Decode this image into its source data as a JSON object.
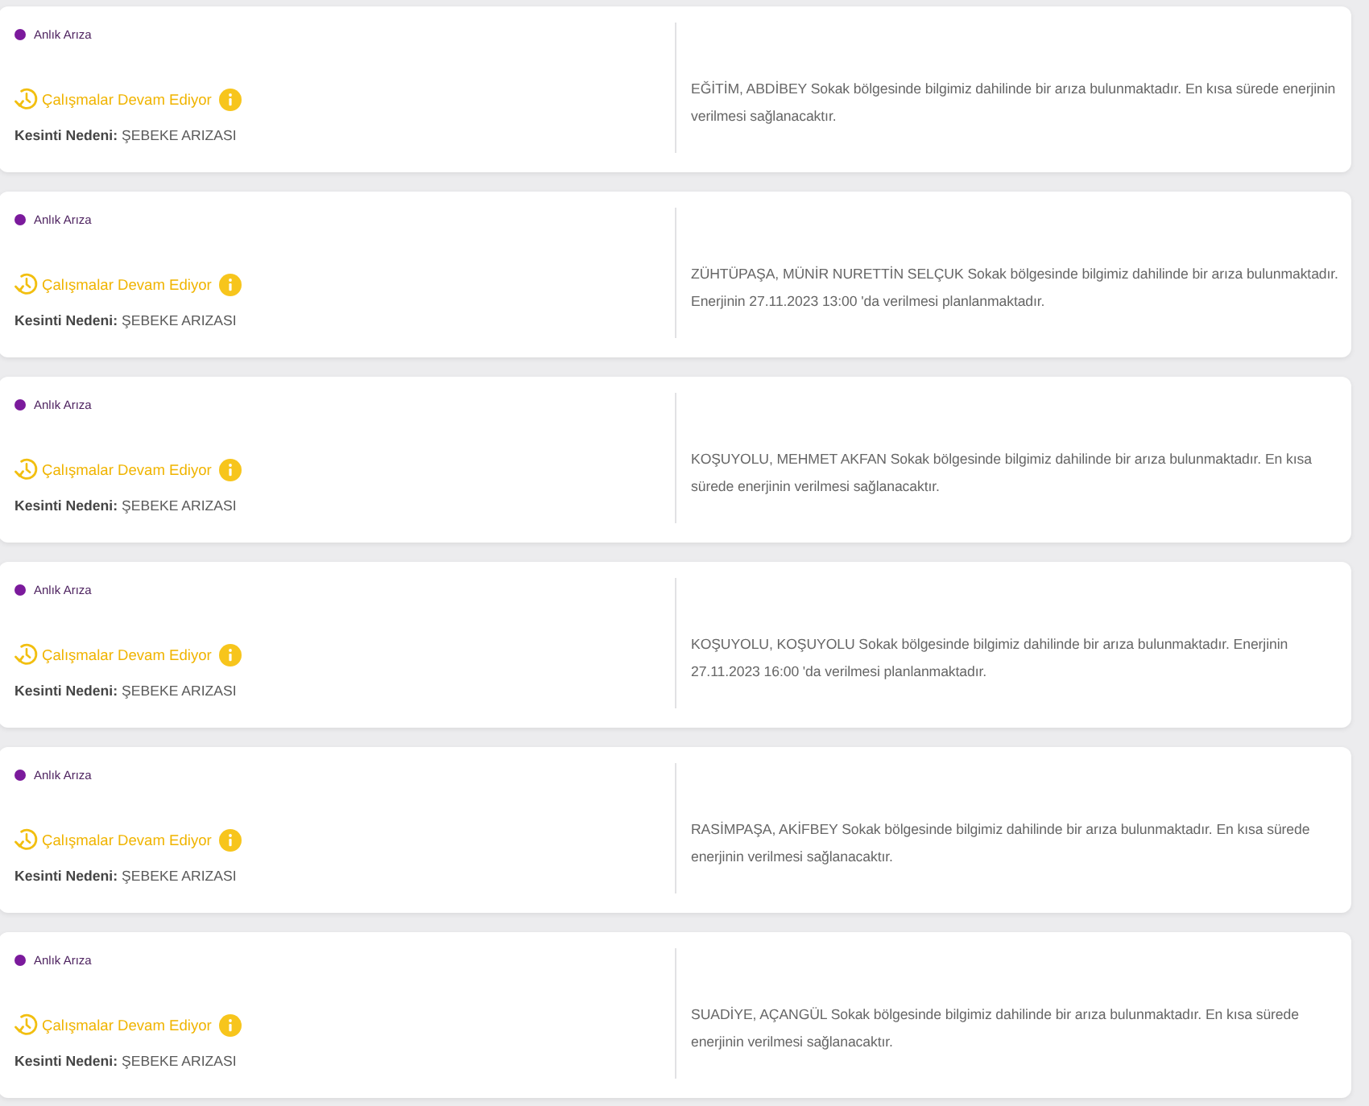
{
  "outages": [
    {
      "type": "Anlık Arıza",
      "status": "Çalışmalar Devam Ediyor",
      "reason": "**Kesinti Nedeni:** ŞEBEKE ARIZASI",
      "description": "EĞİTİM, ABDİBEY Sokak bölgesinde bilgimiz dahilinde bir arıza bulunmaktadır. En kısa sürede enerjinin verilmesi sağlanacaktır."
    },
    {
      "type": "Anlık Arıza",
      "status": "Çalışmalar Devam Ediyor",
      "reason": "**Kesinti Nedeni:** ŞEBEKE ARIZASI",
      "description": "ZÜHTÜPAŞA, MÜNİR NURETTİN SELÇUK Sokak bölgesinde bilgimiz dahilinde bir arıza bulunmaktadır. Enerjinin 27.11.2023 13:00 'da verilmesi planlanmaktadır."
    },
    {
      "type": "Anlık Arıza",
      "status": "Çalışmalar Devam Ediyor",
      "reason": "**Kesinti Nedeni:** ŞEBEKE ARIZASI",
      "description": "KOŞUYOLU, MEHMET AKFAN Sokak bölgesinde bilgimiz dahilinde bir arıza bulunmaktadır. En kısa sürede enerjinin verilmesi sağlanacaktır."
    },
    {
      "type": "Anlık Arıza",
      "status": "Çalışmalar Devam Ediyor",
      "reason": "**Kesinti Nedeni:** ŞEBEKE ARIZASI",
      "description": "KOŞUYOLU, KOŞUYOLU Sokak bölgesinde bilgimiz dahilinde bir arıza bulunmaktadır. Enerjinin 27.11.2023 16:00 'da verilmesi planlanmaktadır."
    },
    {
      "type": "Anlık Arıza",
      "status": "Çalışmalar Devam Ediyor",
      "reason": "**Kesinti Nedeni:** ŞEBEKE ARIZASI",
      "description": "RASİMPAŞA, AKİFBEY Sokak bölgesinde bilgimiz dahilinde bir arıza bulunmaktadır. En kısa sürede enerjinin verilmesi sağlanacaktır."
    },
    {
      "type": "Anlık Arıza",
      "status": "Çalışmalar Devam Ediyor",
      "reason": "**Kesinti Nedeni:** ŞEBEKE ARIZASI",
      "description": "SUADİYE, AÇANGÜL Sokak bölgesinde bilgimiz dahilinde bir arıza bulunmaktadır. En kısa sürede enerjinin verilmesi sağlanacaktır."
    }
  ]
}
